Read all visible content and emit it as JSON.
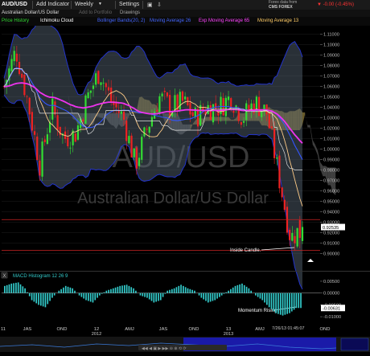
{
  "toolbar": {
    "symbol": "AUD/USD",
    "add_indicator": "Add Indicator",
    "period": "Weekly",
    "settings": "Settings",
    "source_line1": "Forex data from",
    "source_line2": "CMS FOREX",
    "change": "▼ -0.00 (-0.45%)"
  },
  "subbar": {
    "instrument": "Australian Dollar/US Dollar",
    "add_portfolio": "Add to Portfolio",
    "drawings": "Drawings"
  },
  "indicators": [
    {
      "label": "Price History",
      "color": "#33dd33"
    },
    {
      "label": "Ichimoku Cloud",
      "color": "#ffffff"
    },
    {
      "label": "Bollinger Bands(20, 2)",
      "color": "#4466ff"
    },
    {
      "label": "Moving Average 26",
      "color": "#4466ff"
    },
    {
      "label": "Exp Moving Average 65",
      "color": "#ff44ff"
    },
    {
      "label": "Moving Average 13",
      "color": "#ffcc66"
    }
  ],
  "watermark": {
    "symbol": "AUD/USD",
    "name": "Australian Dollar/US Dollar"
  },
  "price_axis": {
    "ticks": [
      "1.11000",
      "1.10000",
      "1.09000",
      "1.08000",
      "1.07000",
      "1.06000",
      "1.05000",
      "1.04000",
      "1.03000",
      "1.02000",
      "1.01000",
      "1.00000",
      "0.99000",
      "0.98000",
      "0.97000",
      "0.96000",
      "0.95000",
      "0.94000",
      "0.93000",
      "0.92000",
      "0.91000",
      "0.90000"
    ],
    "last_price": "0.92535"
  },
  "annotations": {
    "inside_candle": "Inside Candle.",
    "momentum": "Momentum Rising."
  },
  "macd": {
    "label": "MACD Histogram 12 26 9",
    "ticks": [
      "0.00500",
      "0.00000",
      "-0.00500",
      "-0.01000"
    ],
    "last": "-0.00631",
    "close_glyph": "X"
  },
  "x_axis": {
    "labels": [
      {
        "text": "11",
        "sub": ""
      },
      {
        "text": "JAS",
        "sub": ""
      },
      {
        "text": "OND",
        "sub": ""
      },
      {
        "text": "12",
        "sub": "2012"
      },
      {
        "text": "AMJ",
        "sub": ""
      },
      {
        "text": "JAS",
        "sub": ""
      },
      {
        "text": "OND",
        "sub": ""
      },
      {
        "text": "13",
        "sub": "2013"
      },
      {
        "text": "AMJ",
        "sub": ""
      },
      {
        "text": "OND",
        "sub": ""
      }
    ],
    "timestamp": "7/26/13 01:45:07"
  },
  "colors": {
    "bull": "#33dd33",
    "bear": "#ee2222",
    "bollinger": "#2233cc",
    "ema65": "#ee33ee",
    "ma26": "#3355ff",
    "ma13": "#ffcc88",
    "cloud_bull": "#7a6a30",
    "cloud_bear": "#4a4a4a",
    "macd": "#33cccc",
    "hline": "#cc2222"
  },
  "chart_data": [
    {
      "type": "candlestick",
      "title": "AUD/USD Weekly",
      "ylim": [
        0.895,
        1.115
      ],
      "x": [
        "2011-06",
        "2011-07",
        "2011-08",
        "2011-09",
        "2011-10",
        "2011-11",
        "2011-12",
        "2012-01",
        "2012-02",
        "2012-03",
        "2012-04",
        "2012-05",
        "2012-06",
        "2012-07",
        "2012-08",
        "2012-09",
        "2012-10",
        "2012-11",
        "2012-12",
        "2013-01",
        "2013-02",
        "2013-03",
        "2013-04",
        "2013-05",
        "2013-06",
        "2013-07"
      ],
      "close": [
        1.06,
        1.095,
        1.045,
        0.985,
        1.04,
        1.01,
        1.015,
        1.05,
        1.075,
        1.045,
        1.03,
        0.985,
        1.02,
        1.05,
        1.04,
        1.045,
        1.03,
        1.04,
        1.04,
        1.05,
        1.03,
        1.045,
        1.035,
        0.975,
        0.915,
        0.925
      ],
      "horizontal_lines": [
        0.9325,
        0.903
      ]
    },
    {
      "type": "bar",
      "title": "MACD Histogram 12 26 9",
      "ylim": [
        -0.012,
        0.006
      ],
      "values": [
        0.003,
        0.004,
        0.0045,
        0.002,
        -0.003,
        -0.005,
        -0.006,
        -0.002,
        0.001,
        0.003,
        0.002,
        -0.001,
        -0.003,
        -0.004,
        -0.001,
        0.001,
        0.002,
        0.003,
        0.0035,
        0.002,
        -0.001,
        -0.002,
        -0.004,
        -0.003,
        0.001,
        0.002,
        0.0035,
        0.002,
        0.001,
        -0.002,
        -0.004,
        -0.003,
        -0.001,
        0.001,
        0.003,
        0.004,
        0.002,
        -0.001,
        -0.003,
        -0.006,
        -0.0085,
        -0.0095,
        -0.0085,
        -0.00631
      ]
    }
  ]
}
